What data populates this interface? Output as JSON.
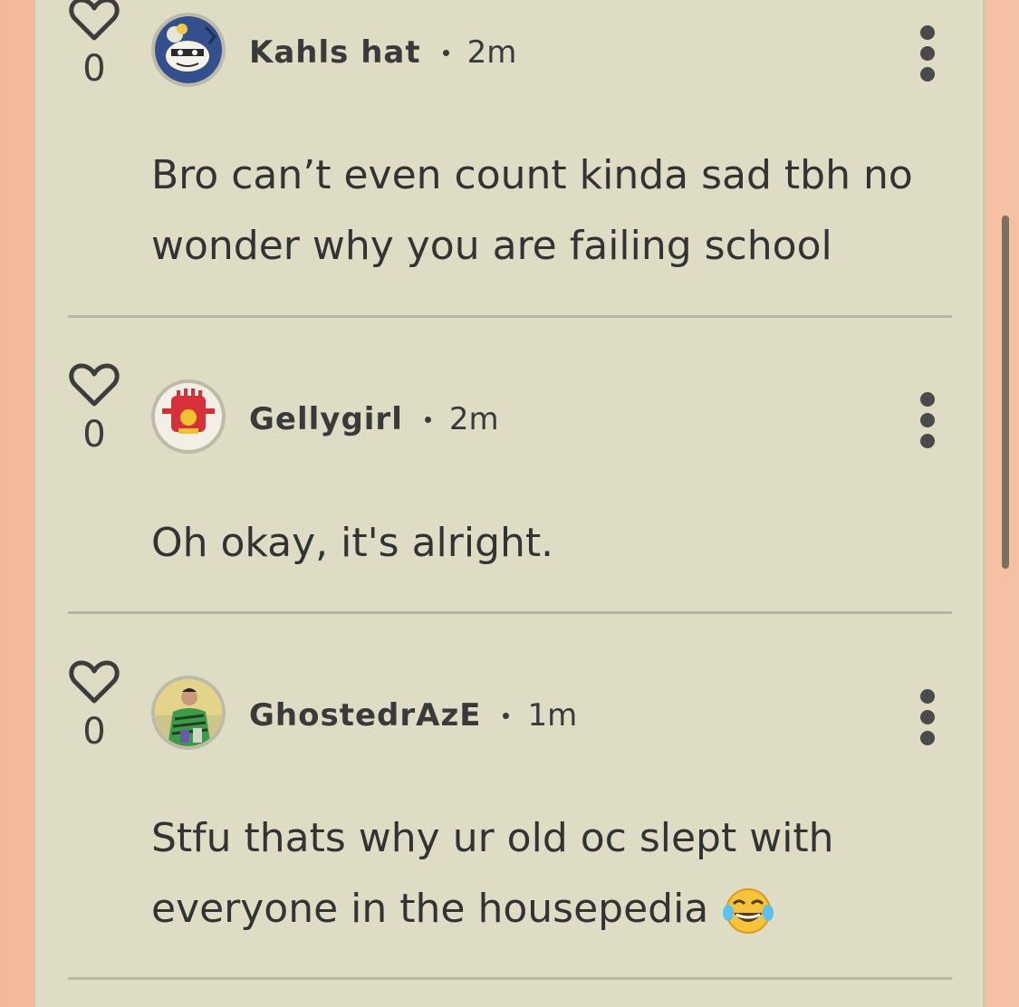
{
  "comments": [
    {
      "likes": "0",
      "username": "Kahls hat",
      "time": "2m",
      "text": "Bro can’t even count kinda sad tbh no wonder why you are failing school",
      "avatar_icon": "cartoon-avatar-blue"
    },
    {
      "likes": "0",
      "username": "Gellygirl",
      "time": "2m",
      "text": "Oh okay, it's alright.",
      "avatar_icon": "cartoon-avatar-red"
    },
    {
      "likes": "0",
      "username": "GhostedrAzE",
      "time": "1m",
      "text": "Stfu thats why ur old oc slept with everyone in the housepedia",
      "emoji": "😂",
      "avatar_icon": "photo-avatar-green-shirt"
    }
  ],
  "colors": {
    "panel_bg": "#dedcc5",
    "page_bg": "#f3bc9d",
    "text": "#333333",
    "scrollbar": "#7d6f60"
  },
  "icons": {
    "like": "heart-outline-icon",
    "menu": "more-vertical-icon",
    "laugh_emoji": "face-with-tears-of-joy-icon"
  }
}
